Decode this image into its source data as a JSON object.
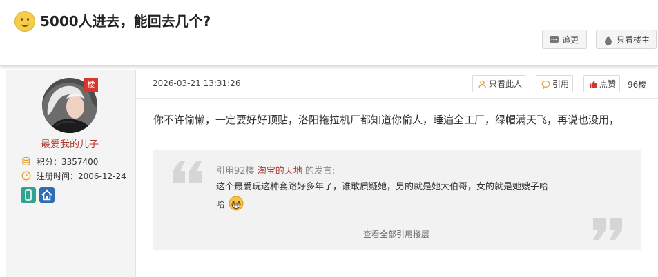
{
  "thread": {
    "title": "5000人进去，能回去几个?"
  },
  "header_buttons": {
    "reply": "追更",
    "only_op": "只看楼主"
  },
  "post": {
    "author": {
      "name": "最爱我的儿子",
      "badge": "楼",
      "points": "积分：3357400",
      "register": "注册时间：2006-12-24"
    },
    "date": "2026-03-21 13:31:26",
    "actions": {
      "only_this": "只看此人",
      "quote": "引用",
      "like": "点赞"
    },
    "floor": "96楼",
    "content": "你不许偷懒，一定要好好顶贴，洛阳拖拉机厂都知道你偷人，睡遍全工厂，绿帽满天飞，再说也没用，",
    "quote_block": {
      "prefix": "引用92楼",
      "user": "淘宝的天地",
      "suffix": "的发言:",
      "line1": "这个最爱玩这种套路好多年了，谁敢质疑她，男的就是她大伯哥，女的就是她嫂子哈",
      "line2": "哈",
      "view_all": "查看全部引用楼层"
    },
    "bottom_partial": "  "
  },
  "colors": {
    "accent": "#b03a2e",
    "like": "#d9362b"
  }
}
